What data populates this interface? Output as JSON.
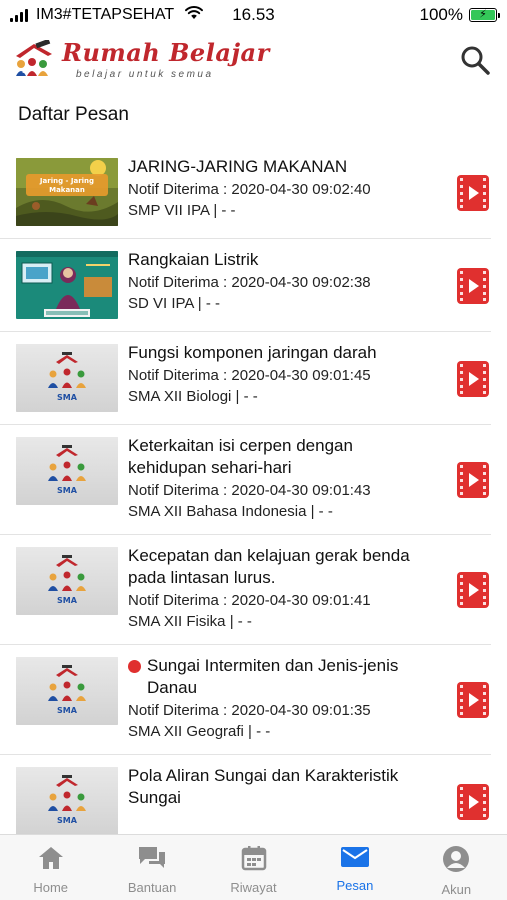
{
  "status_bar": {
    "carrier": "IM3#TETAPSEHAT",
    "time": "16.53",
    "battery_percent_label": "100%",
    "battery_level": 1.0
  },
  "header": {
    "logo_title": "Rumah Belajar",
    "logo_tagline": "belajar untuk semua",
    "search_icon": "search-icon"
  },
  "section_title": "Daftar Pesan",
  "messages": [
    {
      "title": "JARING-JARING MAKANAN",
      "received": "Notif Diterima : 2020-04-30 09:02:40",
      "subtitle": "SMP VII IPA | - -",
      "thumb": "jaring",
      "thumb_text": "Jaring - Jaring Makanan",
      "unread": false
    },
    {
      "title": "Rangkaian Listrik",
      "received": "Notif Diterima : 2020-04-30 09:02:38",
      "subtitle": "SD VI IPA | - -",
      "thumb": "listrik",
      "unread": false
    },
    {
      "title": "Fungsi komponen jaringan darah",
      "received": "Notif Diterima : 2020-04-30 09:01:45",
      "subtitle": "SMA XII Biologi | - -",
      "thumb": "sma",
      "thumb_text": "SMA",
      "unread": false
    },
    {
      "title": "Keterkaitan isi cerpen dengan kehidupan sehari-hari",
      "received": "Notif Diterima : 2020-04-30 09:01:43",
      "subtitle": "SMA XII Bahasa Indonesia | - -",
      "thumb": "sma",
      "thumb_text": "SMA",
      "unread": false
    },
    {
      "title": "Kecepatan dan kelajuan gerak benda pada lintasan lurus.",
      "received": "Notif Diterima : 2020-04-30 09:01:41",
      "subtitle": "SMA XII Fisika | - -",
      "thumb": "sma",
      "thumb_text": "SMA",
      "unread": false
    },
    {
      "title": "Sungai Intermiten dan Jenis-jenis Danau",
      "received": "Notif Diterima : 2020-04-30 09:01:35",
      "subtitle": "SMA XII Geografi | - -",
      "thumb": "sma",
      "thumb_text": "SMA",
      "unread": true
    },
    {
      "title": "Pola Aliran Sungai dan Karakteristik Sungai",
      "received": "",
      "subtitle": "",
      "thumb": "sma",
      "thumb_text": "SMA",
      "unread": false
    }
  ],
  "tabs": [
    {
      "label": "Home",
      "icon": "home-icon",
      "active": false
    },
    {
      "label": "Bantuan",
      "icon": "chat-icon",
      "active": false
    },
    {
      "label": "Riwayat",
      "icon": "calendar-icon",
      "active": false
    },
    {
      "label": "Pesan",
      "icon": "mail-icon",
      "active": true
    },
    {
      "label": "Akun",
      "icon": "account-icon",
      "active": false
    }
  ],
  "colors": {
    "brand_red": "#c0272d",
    "video_red": "#e0302f",
    "active_tab": "#1a73e8",
    "inactive_tab": "#8e8e8e"
  }
}
